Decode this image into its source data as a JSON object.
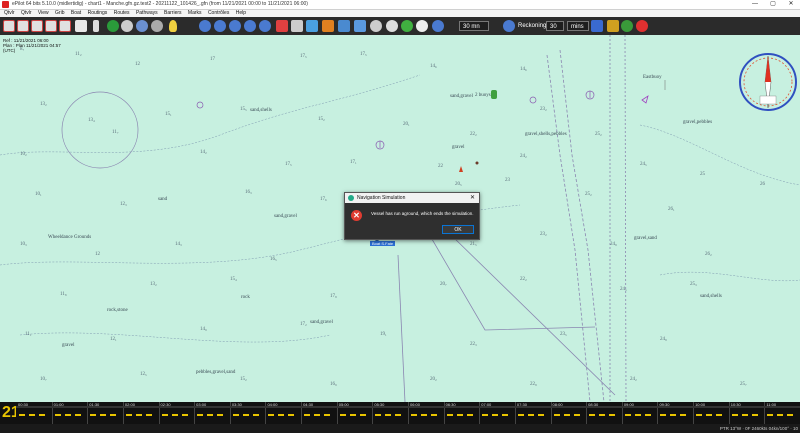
{
  "window": {
    "title": "ePilot 64 bits 5.10.0 (midlertidig) - chart1 - Manche.gfn.gz.test2 - 20211122_101426_.gfn (from 11/21/2021 00:00 to 11/21/2021 06:00)",
    "minimize_label": "—",
    "maximize_label": "▢",
    "close_label": "✕"
  },
  "menu": [
    "Qtvlr",
    "Qtvlr",
    "View",
    "Grib",
    "Boat",
    "Routings",
    "Routes",
    "Pathways",
    "Barriers",
    "Marks",
    "Contrôles",
    "Help"
  ],
  "toolbar": {
    "time_step": "30 mn",
    "reckoning_label": "Reckoning",
    "reckoning_value": "30",
    "reckoning_unit": "mins"
  },
  "info_box": {
    "line1": "Ref : 11/21/2021 06:00",
    "line2": "Ref. : 11/21/2021 06:30",
    "line3": "Plan : Plan 11/21/2021 04:57",
    "line4": "(UTC)"
  },
  "dialog": {
    "title": "Navigation Simulation",
    "message": "Vessel has run aground, which ends the simulation.",
    "ok_label": "OK"
  },
  "boat_label": "Boat S.Fate",
  "chart_labels": [
    {
      "text": "Wheeldance Grounds"
    },
    {
      "text": "sand,shells"
    },
    {
      "text": "sand,gravel"
    },
    {
      "text": "gravel,shells,pebbles"
    },
    {
      "text": "gravel,pebbles"
    },
    {
      "text": "sand,gravel"
    },
    {
      "text": "rock,stone"
    },
    {
      "text": "pebbles,gravel,sand"
    },
    {
      "text": "gravel,sand"
    },
    {
      "text": "sand,shells"
    },
    {
      "text": "gravel"
    },
    {
      "text": "rock"
    },
    {
      "text": "sand,gravel"
    },
    {
      "text": "gravel"
    },
    {
      "text": "sand"
    },
    {
      "text": "2 buoys"
    },
    {
      "text": "Eastbuoy"
    }
  ],
  "scale": {
    "big_number": "21",
    "ticks": [
      "00:30",
      "01:00",
      "01:30",
      "02:00",
      "02:30",
      "03:00",
      "03:30",
      "04:00",
      "04:30",
      "05:00",
      "05:30",
      "06:00",
      "06:30",
      "07:00",
      "07:30",
      "08:00",
      "08:30",
      "09:00",
      "09:30",
      "10:00",
      "10:30",
      "11:00"
    ]
  },
  "statusbar": {
    "right": "PTR 13°W · 0F 2460kts 04kn/100° · 10"
  },
  "colors": {
    "sea": "#c7f0e0",
    "toolbar": "#2b2b2b",
    "dialog": "#2f2f2f",
    "error": "#e03c31",
    "accent": "#0a74d4"
  }
}
